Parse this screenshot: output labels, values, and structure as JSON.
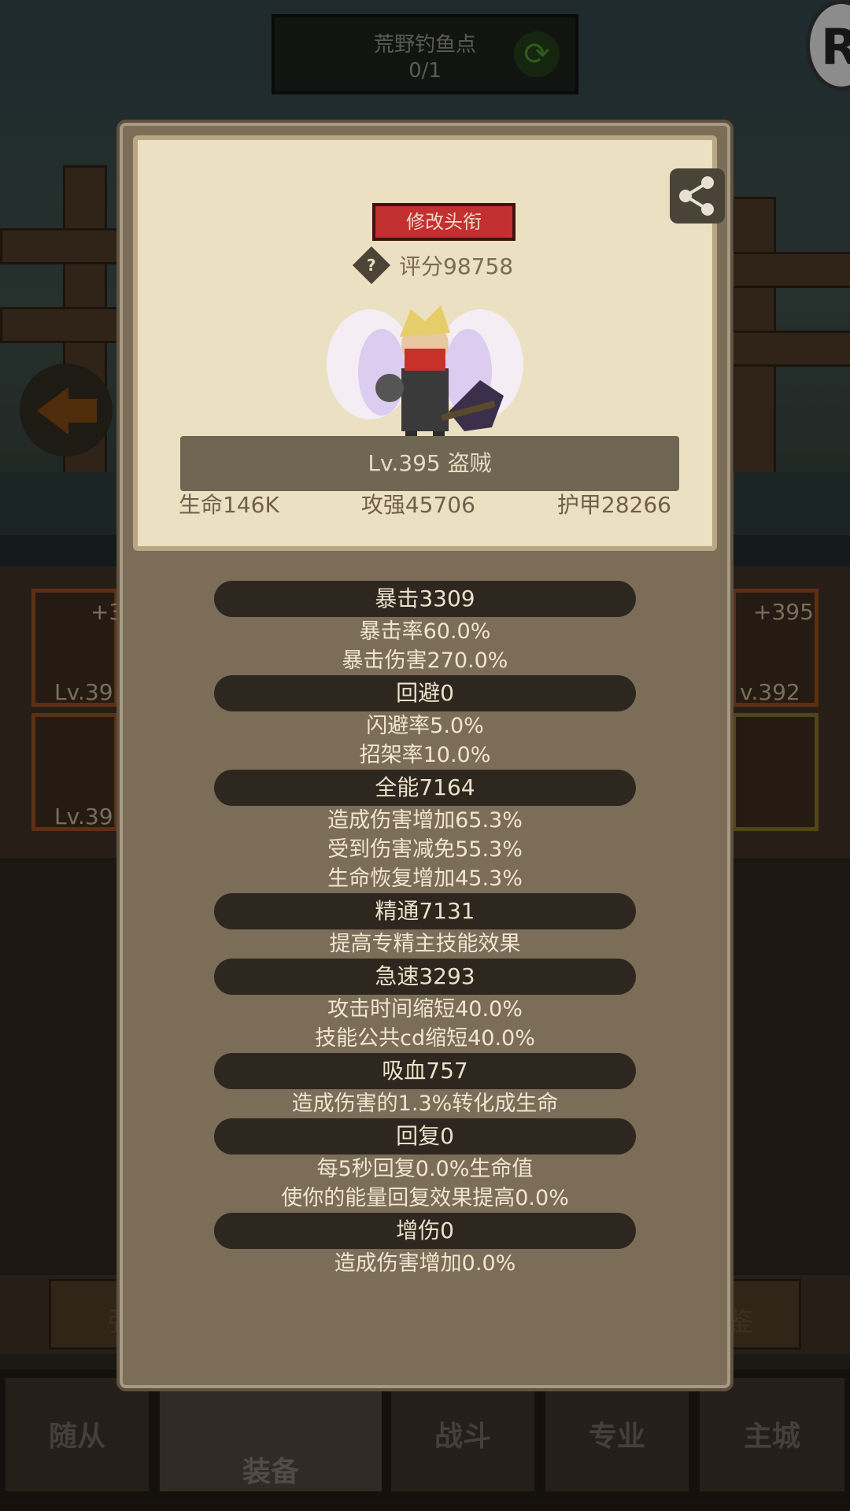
{
  "background": {
    "quest": {
      "title": "荒野钓鱼点",
      "count": "0/1"
    },
    "corner_badge": "R",
    "slots": {
      "left_top_plus": "+3",
      "left_top_level": "Lv.39",
      "left_bottom_level": "Lv.39",
      "right_top_plus": "+395",
      "right_top_level": "v.392"
    },
    "side_buttons": {
      "left": "强",
      "right": "鉴"
    },
    "nav": [
      "随从",
      "装备",
      "战斗",
      "专业",
      "主城"
    ]
  },
  "popup": {
    "title_button": "修改头衔",
    "score": "评分98758",
    "level": "Lv.395 盗贼",
    "stats": [
      "生命146K",
      "攻强45706",
      "护甲28266"
    ],
    "sections": [
      {
        "head": "暴击3309",
        "lines": [
          "暴击率60.0%",
          "暴击伤害270.0%"
        ]
      },
      {
        "head": "回避0",
        "lines": [
          "闪避率5.0%",
          "招架率10.0%"
        ]
      },
      {
        "head": "全能7164",
        "lines": [
          "造成伤害增加65.3%",
          "受到伤害减免55.3%",
          "生命恢复增加45.3%"
        ]
      },
      {
        "head": "精通7131",
        "lines": [
          "提高专精主技能效果"
        ]
      },
      {
        "head": "急速3293",
        "lines": [
          "攻击时间缩短40.0%",
          "技能公共cd缩短40.0%"
        ]
      },
      {
        "head": "吸血757",
        "lines": [
          "造成伤害的1.3%转化成生命"
        ]
      },
      {
        "head": "回复0",
        "lines": [
          "每5秒回复0.0%生命值",
          "使你的能量回复效果提高0.0%"
        ]
      },
      {
        "head": "增伤0",
        "lines": [
          "造成伤害增加0.0%"
        ]
      }
    ]
  }
}
